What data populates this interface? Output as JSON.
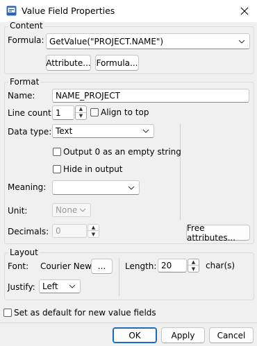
{
  "window": {
    "title": "Value Field Properties",
    "icon": "value-field-icon",
    "close_icon": "close-icon"
  },
  "content": {
    "group_label": "Content",
    "formula_label": "Formula:",
    "formula_value": "GetValue(\"PROJECT.NAME\")",
    "attribute_button": "Attribute...",
    "formula_button": "Formula..."
  },
  "format": {
    "group_label": "Format",
    "name_label": "Name:",
    "name_value": "NAME_PROJECT",
    "line_count_label": "Line count",
    "line_count_value": "1",
    "align_to_top_label": "Align to top",
    "align_to_top_checked": false,
    "data_type_label": "Data type:",
    "data_type_value": "Text",
    "output_zero_label": "Output 0 as an empty string",
    "output_zero_checked": false,
    "hide_in_output_label": "Hide in output",
    "hide_in_output_checked": false,
    "meaning_label": "Meaning:",
    "meaning_value": "",
    "unit_label": "Unit:",
    "unit_value": "None",
    "decimals_label": "Decimals:",
    "decimals_value": "0",
    "free_attributes_button": "Free attributes..."
  },
  "layout": {
    "group_label": "Layout",
    "font_label": "Font:",
    "font_value": "Courier New",
    "font_button": "...",
    "length_label": "Length:",
    "length_value": "20",
    "length_unit": "char(s)",
    "justify_label": "Justify:",
    "justify_value": "Left"
  },
  "footer": {
    "default_checkbox_label": "Set as default for new value fields",
    "default_checked": false,
    "ok_button": "OK",
    "apply_button": "Apply",
    "cancel_button": "Cancel"
  },
  "colors": {
    "accent": "#1a69bb",
    "background": "#f0f0f0",
    "title_bar": "#ffffff"
  }
}
